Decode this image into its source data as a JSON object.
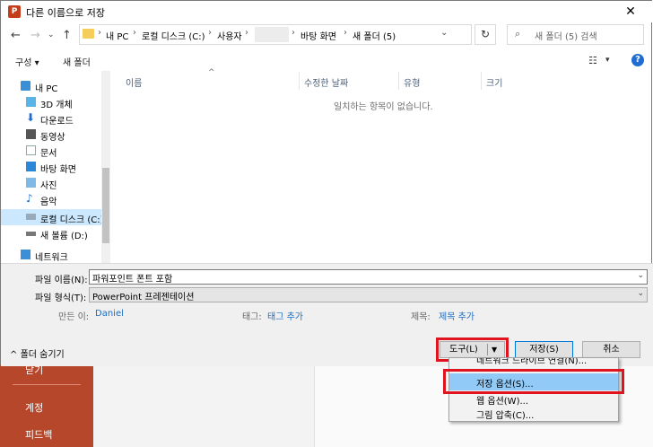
{
  "background": {
    "sidebar_items": [
      "닫기",
      "계정",
      "피드백"
    ]
  },
  "dialog": {
    "title": "다른 이름으로 저장",
    "address": {
      "crumbs": [
        "내 PC",
        "로컬 디스크 (C:)",
        "사용자",
        "바탕 화면",
        "새 폴더 (5)"
      ]
    },
    "search_placeholder": "새 폴더 (5) 검색",
    "toolbar": {
      "organize": "구성 ▾",
      "new_folder": "새 폴더"
    },
    "nav_items": [
      {
        "label": "내 PC",
        "icon": "pc-icon"
      },
      {
        "label": "3D 개체",
        "icon": "cube-icon"
      },
      {
        "label": "다운로드",
        "icon": "download-icon"
      },
      {
        "label": "동영상",
        "icon": "video-icon"
      },
      {
        "label": "문서",
        "icon": "document-icon"
      },
      {
        "label": "바탕 화면",
        "icon": "desktop-icon"
      },
      {
        "label": "사진",
        "icon": "pictures-icon"
      },
      {
        "label": "음악",
        "icon": "music-icon"
      },
      {
        "label": "로컬 디스크 (C:)",
        "icon": "drive-icon"
      },
      {
        "label": "새 볼륨 (D:)",
        "icon": "drive-icon"
      },
      {
        "label": "네트워크",
        "icon": "network-icon"
      }
    ],
    "columns": [
      "이름",
      "수정한 날짜",
      "유형",
      "크기"
    ],
    "empty_message": "일치하는 항목이 없습니다.",
    "filename_label": "파일 이름(N):",
    "filename_value": "파워포인트 폰트 포함",
    "filetype_label": "파일 형식(T):",
    "filetype_value": "PowerPoint 프레젠테이션",
    "author_label": "만든 이:",
    "author_value": "Daniel",
    "tags_label": "태그:",
    "tags_value": "태그 추가",
    "title_label": "제목:",
    "title_value": "제목 추가",
    "hide_folders": "폴더 숨기기",
    "tools_button": "도구(L)",
    "save_button": "저장(S)",
    "cancel_button": "취소"
  },
  "tools_menu": {
    "items": [
      "네트워크 드라이브 연결(N)...",
      "저장 옵션(S)...",
      "웹 옵션(W)...",
      "그림 압축(C)..."
    ]
  },
  "colors": {
    "powerpoint_brand": "#b7472a",
    "highlight": "#e0141e",
    "selection": "#91c9f7"
  }
}
